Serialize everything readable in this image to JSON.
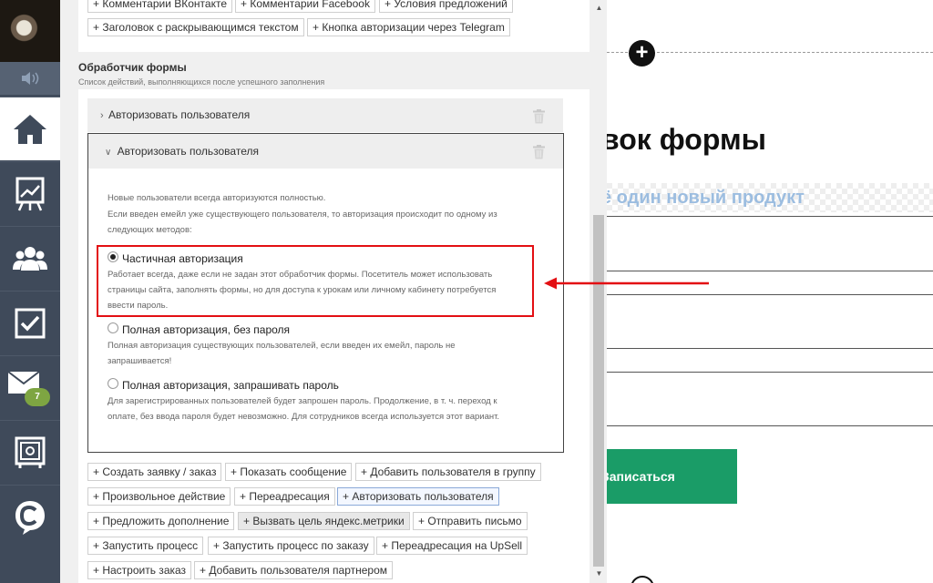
{
  "sidebar": {
    "mail_badge": "7"
  },
  "top_buttons": {
    "row1": [
      "+ Комментарии ВКонтакте",
      "+ Комментарии Facebook",
      "+ Условия предложений"
    ],
    "row2": [
      "+ Заголовок с раскрывающимся текстом",
      "+ Кнопка авторизации через Telegram"
    ]
  },
  "section": {
    "title": "Обработчик формы",
    "subtitle": "Список действий, выполняющихся после успешного заполнения"
  },
  "items": {
    "collapsed_label": "Авторизовать пользователя",
    "open_label": "Авторизовать пользователя"
  },
  "description": {
    "line1": "Новые пользователи всегда авторизуются полностью.",
    "line2": "Если введен емейл уже существующего пользователя, то авторизация происходит по одному из",
    "line3": "следующих методов:"
  },
  "options": [
    {
      "label": "Частичная авторизация",
      "desc1": "Работает всегда, даже если не задан этот обработчик формы. Посетитель может использовать",
      "desc2": "страницы сайта, заполнять формы, но для доступа к урокам или личному кабинету потребуется",
      "desc3": "ввести пароль.",
      "selected": true
    },
    {
      "label": "Полная авторизация, без пароля",
      "desc1": "Полная авторизация существующих пользователей, если введен их емейл, пароль не",
      "desc2": "запрашивается!",
      "selected": false
    },
    {
      "label": "Полная авторизация, запрашивать пароль",
      "desc1": "Для зарегистрированных пользователей будет запрошен пароль. Продолжение, в т. ч. переход к",
      "desc2": "оплате, без ввода пароля будет невозможно. Для сотрудников всегда используется этот вариант.",
      "selected": false
    }
  ],
  "action_buttons": {
    "row1": [
      "+ Создать заявку / заказ",
      "+ Показать сообщение",
      "+ Добавить пользователя в группу"
    ],
    "row2": [
      "+ Произвольное действие",
      "+ Переадресация",
      "+ Авторизовать пользователя"
    ],
    "row3": [
      "+ Предложить дополнение",
      "+ Вызвать цель яндекс.метрики",
      "+ Отправить письмо"
    ],
    "row4": [
      "+ Запустить процесс",
      "+ Запустить процесс по заказу",
      "+ Переадресация на UpSell"
    ],
    "row5": [
      "+ Настроить заказ",
      "+ Добавить пользователя партнером"
    ]
  },
  "preview": {
    "title": "вок формы",
    "subtitle": "ё один новый продукт",
    "button": "Записаться",
    "plus": "+"
  },
  "colors": {
    "highlight_red": "#e30f13",
    "sidebar_bg": "#3f4a5a",
    "badge_green": "#7ea542",
    "cta_green": "#1a9c67"
  }
}
